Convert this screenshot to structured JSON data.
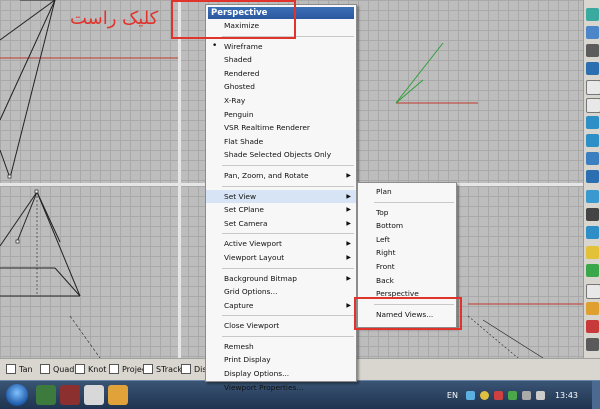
{
  "annotation": {
    "arabic_text": "کلیک راست"
  },
  "viewports": {
    "top_label": ""
  },
  "context_menu": {
    "title": "Perspective",
    "groups": [
      [
        {
          "label": "Maximize"
        }
      ],
      [
        {
          "label": "Wireframe",
          "checked": true
        },
        {
          "label": "Shaded"
        },
        {
          "label": "Rendered"
        },
        {
          "label": "Ghosted"
        },
        {
          "label": "X-Ray"
        },
        {
          "label": "Penguin"
        },
        {
          "label": "VSR Realtime Renderer"
        },
        {
          "label": "Flat Shade"
        },
        {
          "label": "Shade Selected Objects Only"
        }
      ],
      [
        {
          "label": "Pan, Zoom, and Rotate",
          "submenu": true
        }
      ],
      [
        {
          "label": "Set View",
          "submenu": true,
          "highlighted": true
        },
        {
          "label": "Set CPlane",
          "submenu": true
        },
        {
          "label": "Set Camera",
          "submenu": true
        }
      ],
      [
        {
          "label": "Active Viewport",
          "submenu": true
        },
        {
          "label": "Viewport Layout",
          "submenu": true
        }
      ],
      [
        {
          "label": "Background Bitmap",
          "submenu": true
        },
        {
          "label": "Grid Options..."
        },
        {
          "label": "Capture",
          "submenu": true
        }
      ],
      [
        {
          "label": "Close Viewport"
        }
      ],
      [
        {
          "label": "Remesh"
        },
        {
          "label": "Print Display"
        },
        {
          "label": "Display Options..."
        },
        {
          "label": "Viewport Properties..."
        }
      ]
    ]
  },
  "set_view_submenu": {
    "groups": [
      [
        {
          "label": "Plan"
        }
      ],
      [
        {
          "label": "Top"
        },
        {
          "label": "Bottom"
        },
        {
          "label": "Left"
        },
        {
          "label": "Right"
        },
        {
          "label": "Front"
        },
        {
          "label": "Back"
        },
        {
          "label": "Perspective"
        }
      ],
      [
        {
          "label": "Named Views..."
        }
      ]
    ]
  },
  "statusbar": {
    "snaps": [
      {
        "label": "Tan"
      },
      {
        "label": "Quad"
      },
      {
        "label": "Knot"
      },
      {
        "label": "Project"
      },
      {
        "label": "STrack"
      },
      {
        "label": "Disab"
      }
    ]
  },
  "taskbar": {
    "language": "EN",
    "clock": "13:43"
  },
  "colors": {
    "accent_red": "#e0332b",
    "menu_title_blue": "#2b58a0",
    "grid_gray": "#bdbdbd",
    "axis_red": "#c0392b",
    "axis_green": "#2e9e3a"
  }
}
